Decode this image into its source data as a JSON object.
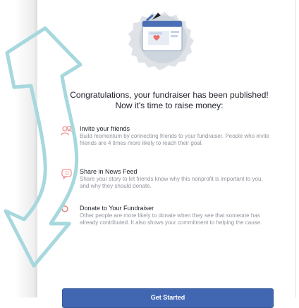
{
  "heading": {
    "line1": "Congratulations, your fundraiser has been published!",
    "line2": "Now it's time to raise money:"
  },
  "steps": [
    {
      "title": "Invite your friends",
      "description": "Build momentum by connecting friends to your fundraiser. People who invite friends are 4 times more likely to reach their goal.",
      "icon": "friends-icon"
    },
    {
      "title": "Share in News Feed",
      "description": "Share your story to let friends know why this nonprofit is important to you, and why they should donate.",
      "icon": "share-icon"
    },
    {
      "title": "Donate to Your Fundraiser",
      "description": "Other people are more likely to donate when they see that someone has already contributed. It also shows your commitment to helping the cause.",
      "icon": "donate-icon"
    }
  ],
  "cta": {
    "label": "Get Started"
  },
  "colors": {
    "accent": "#4267b2",
    "icon": "#e9716d",
    "overlay_arrow": "#a6d8de"
  }
}
